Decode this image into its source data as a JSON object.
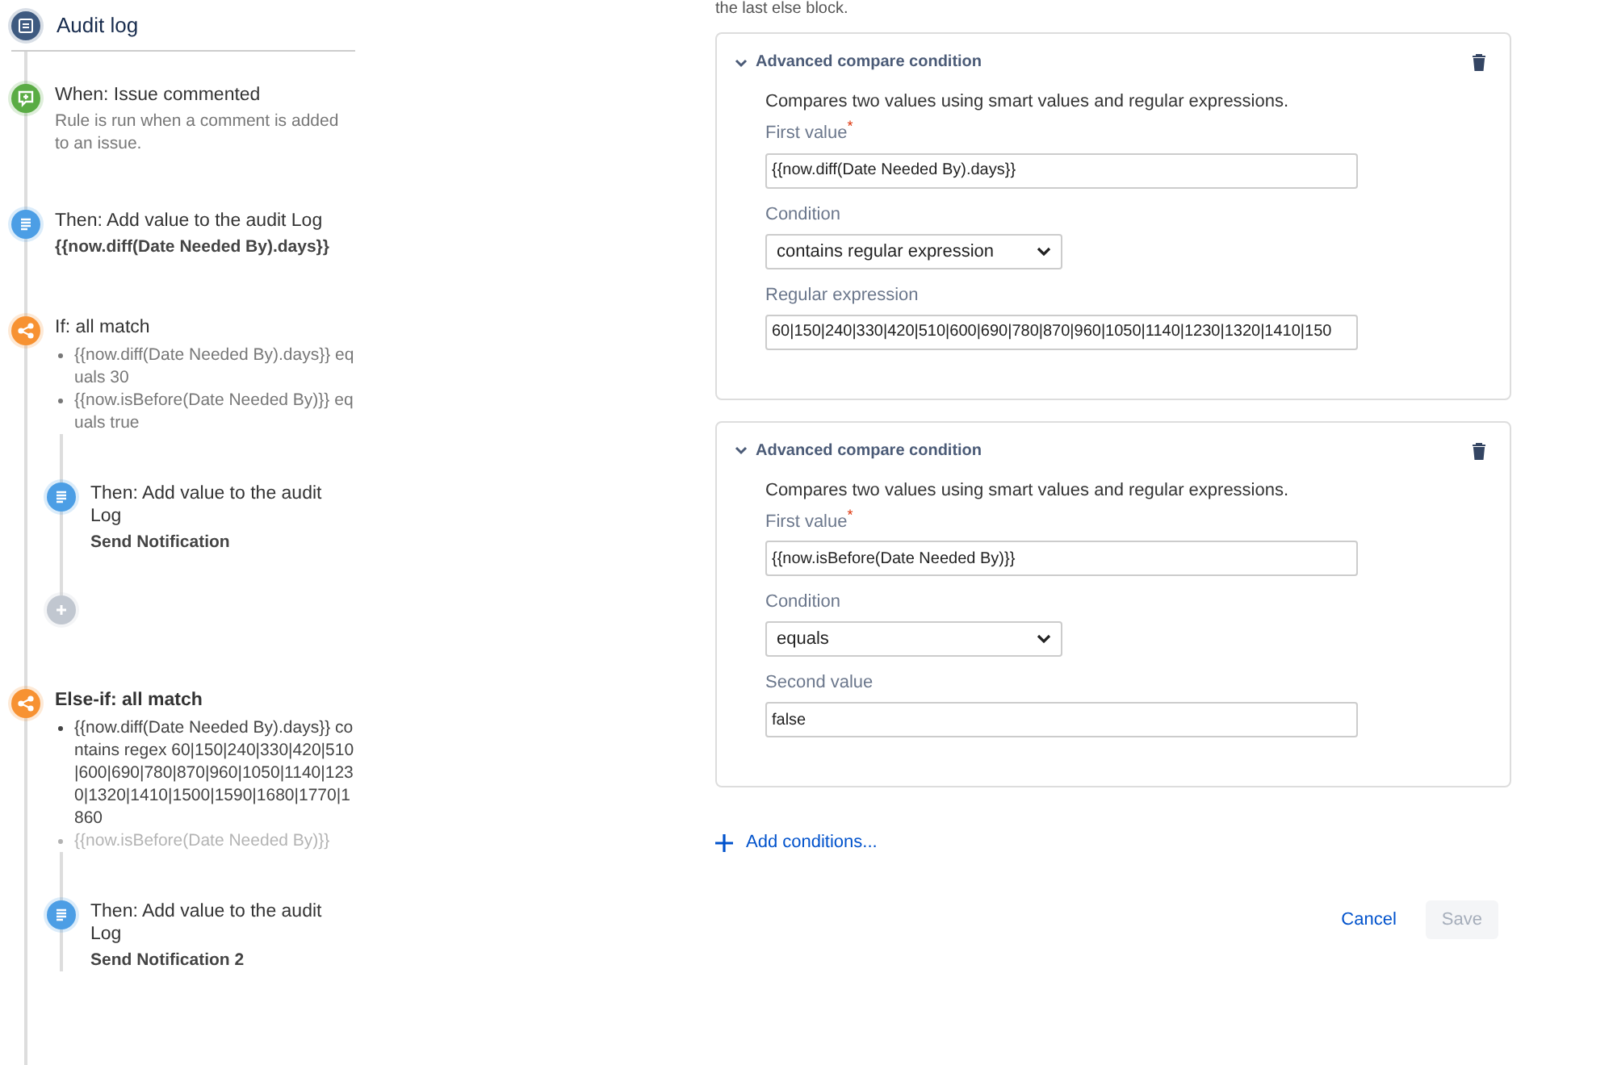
{
  "sidebar": {
    "title": "Audit log",
    "steps": [
      {
        "kind": "trigger",
        "title": "When: Issue commented",
        "description": "Rule is run when a comment is added to an issue."
      },
      {
        "kind": "action",
        "title": "Then: Add value to the audit Log",
        "detail": "{{now.diff(Date Needed By).days}}"
      },
      {
        "kind": "condition",
        "title": "If: all match",
        "selected": false,
        "items": [
          {
            "text": "{{now.diff(Date Needed By).days}} equals 30",
            "faded": false
          },
          {
            "text": "{{now.isBefore(Date Needed By)}} equals true",
            "faded": false
          }
        ],
        "children": [
          {
            "kind": "action",
            "title": "Then: Add value to the audit Log",
            "detail": "Send Notification"
          },
          {
            "kind": "add"
          }
        ]
      },
      {
        "kind": "condition",
        "title": "Else-if: all match",
        "selected": true,
        "items": [
          {
            "text": "{{now.diff(Date Needed By).days}} contains regex 60|150|240|330|420|510|600|690|780|870|960|1050|1140|1230|1320|1410|1500|1590|1680|1770|1860",
            "faded": false
          },
          {
            "text": "{{now.isBefore(Date Needed By)}}",
            "faded": true
          }
        ],
        "children": [
          {
            "kind": "action",
            "title": "Then: Add value to the audit Log",
            "detail": "Send Notification 2"
          }
        ]
      }
    ]
  },
  "editor": {
    "note": "the last else block.",
    "conditions": [
      {
        "title": "Advanced compare condition",
        "expanded": true,
        "description": "Compares two values using smart values and regular expressions.",
        "fields": [
          {
            "kind": "text",
            "label": "First value",
            "required_mark": "*",
            "value": "{{now.diff(Date Needed By).days}}"
          },
          {
            "kind": "select",
            "label": "Condition",
            "value": "contains regular expression"
          },
          {
            "kind": "text",
            "label": "Regular expression",
            "value": "60|150|240|330|420|510|600|690|780|870|960|1050|1140|1230|1320|1410|150"
          }
        ]
      },
      {
        "title": "Advanced compare condition",
        "expanded": true,
        "description": "Compares two values using smart values and regular expressions.",
        "fields": [
          {
            "kind": "text",
            "label": "First value",
            "required_mark": "*",
            "value": "{{now.isBefore(Date Needed By)}}"
          },
          {
            "kind": "select",
            "label": "Condition",
            "value": "equals"
          },
          {
            "kind": "text",
            "label": "Second value",
            "value": "false"
          }
        ]
      }
    ],
    "add_link": "Add conditions...",
    "buttons": [
      {
        "label": "Cancel",
        "kind": "link",
        "disabled": false
      },
      {
        "label": "Save",
        "kind": "primary",
        "disabled": true
      }
    ]
  }
}
